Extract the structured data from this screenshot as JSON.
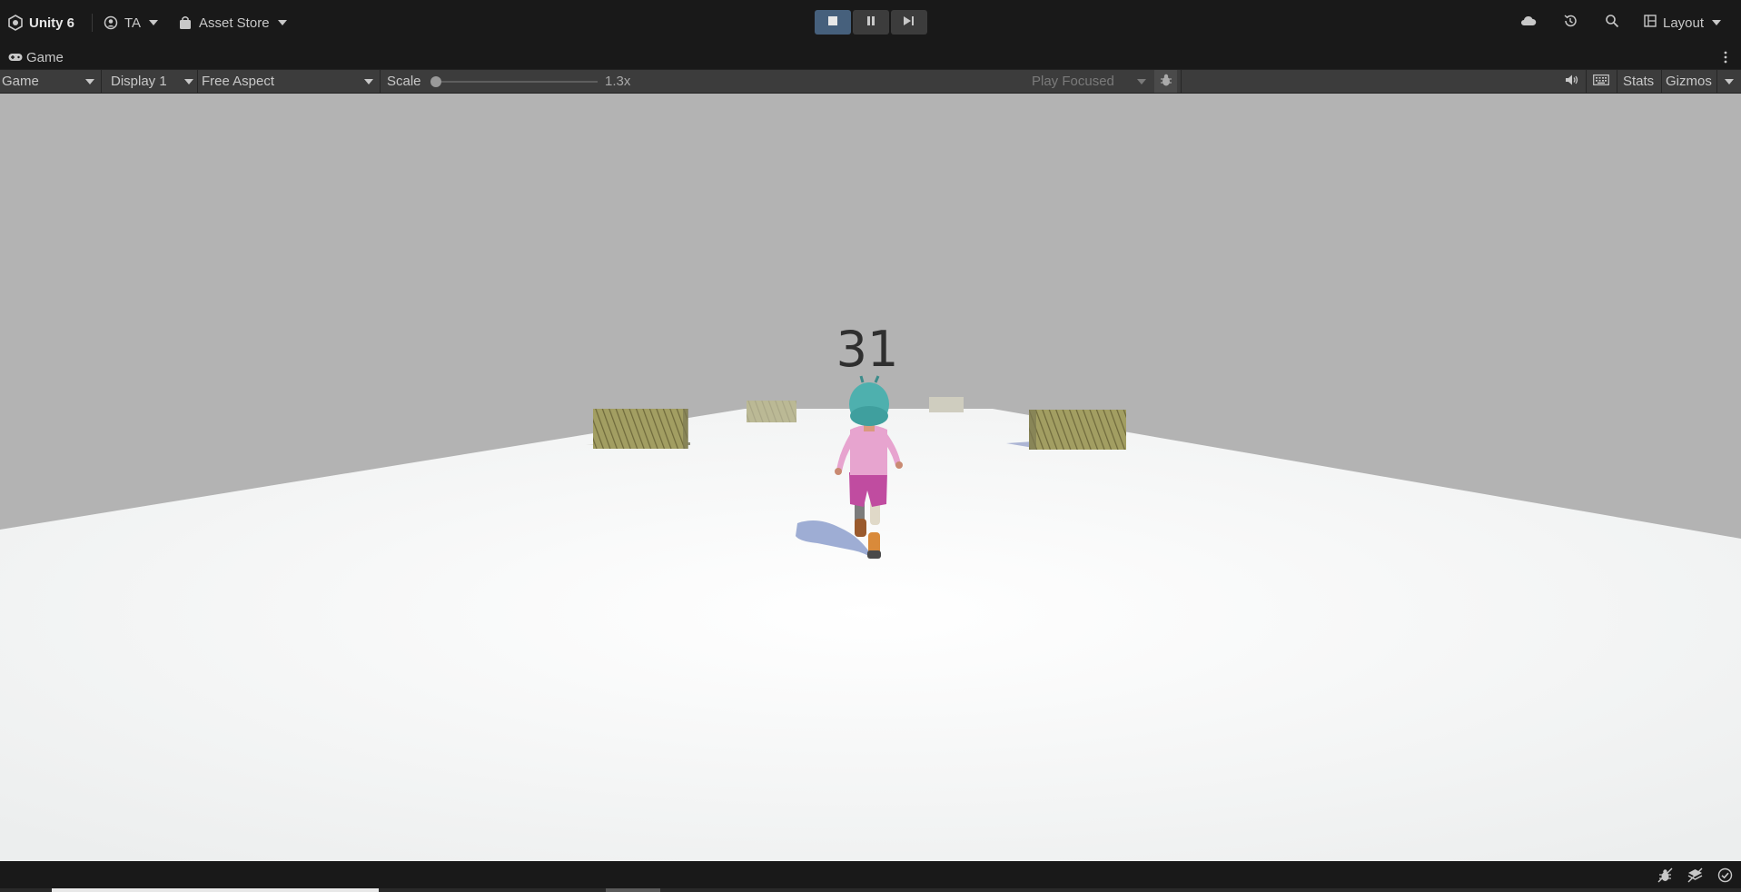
{
  "topbar": {
    "product": "Unity 6",
    "account": "TA",
    "asset_store": "Asset Store",
    "layout": "Layout",
    "icons": [
      "unity-logo-icon",
      "account-icon",
      "asset-store-bag-icon",
      "cloud-icon",
      "history-icon",
      "search-icon",
      "layout-icon"
    ]
  },
  "playmode": {
    "buttons": [
      "stop-icon",
      "pause-icon",
      "step-icon"
    ],
    "active_color": "#46607c"
  },
  "tab": {
    "label": "Game"
  },
  "toolbar": {
    "view_select": "Game",
    "display_select": "Display 1",
    "aspect_select": "Free Aspect",
    "scale_label": "Scale",
    "scale_value": "1.3x",
    "play_mode_select": "Play Focused",
    "stats_label": "Stats",
    "gizmos_label": "Gizmos"
  },
  "game": {
    "score": "31",
    "sky_color": "#b3b3b3",
    "ground_color": "#eef0f0"
  },
  "statusbar": {
    "icons": [
      "bug-icon",
      "layers-icon",
      "check-icon"
    ]
  }
}
